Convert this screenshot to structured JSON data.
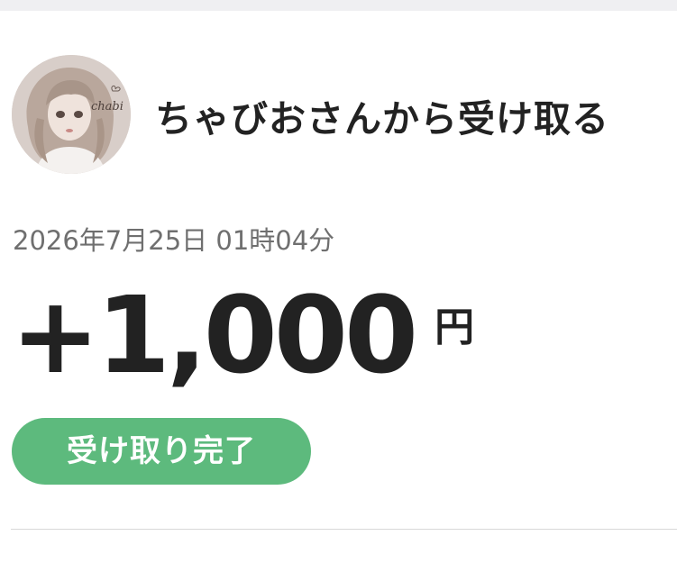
{
  "header": {
    "sender_title": "ちゃびおさんから受け取る",
    "avatar_logo_text": "chabi"
  },
  "transaction": {
    "datetime": "2026年7月25日 01時04分",
    "amount": "+1,000",
    "currency_unit": "円",
    "status_label": "受け取り完了"
  },
  "colors": {
    "status_green": "#5dba7d",
    "text_primary": "#222222",
    "text_secondary": "#6f6f6f"
  }
}
